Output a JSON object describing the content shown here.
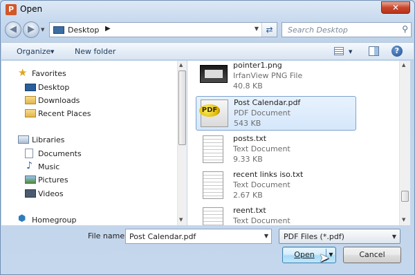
{
  "window": {
    "title": "Open",
    "app_icon_letter": "P"
  },
  "address": {
    "location": "Desktop",
    "search_placeholder": "Search Desktop"
  },
  "toolbar": {
    "organize_label": "Organize",
    "new_folder_label": "New folder",
    "help_label": "?"
  },
  "nav": {
    "favorites": "Favorites",
    "favorites_items": [
      "Desktop",
      "Downloads",
      "Recent Places"
    ],
    "libraries": "Libraries",
    "libraries_items": [
      "Documents",
      "Music",
      "Pictures",
      "Videos"
    ],
    "homegroup": "Homegroup"
  },
  "files": [
    {
      "name": "pointer1.png",
      "type": "IrfanView PNG File",
      "size": "40.8 KB",
      "icon": "image-thumbnail-icon"
    },
    {
      "name": "Post Calendar.pdf",
      "type": "PDF Document",
      "size": "543 KB",
      "icon": "pdf-file-icon",
      "selected": true
    },
    {
      "name": "posts.txt",
      "type": "Text Document",
      "size": "9.33 KB",
      "icon": "text-file-icon"
    },
    {
      "name": "recent links iso.txt",
      "type": "Text Document",
      "size": "2.67 KB",
      "icon": "text-file-icon"
    },
    {
      "name": "reent.txt",
      "type": "Text Document",
      "size": "",
      "icon": "text-file-icon"
    }
  ],
  "footer": {
    "file_name_label": "File name:",
    "file_name_value": "Post Calendar.pdf",
    "file_type_value": "PDF Files (*.pdf)",
    "open_label": "Open",
    "cancel_label": "Cancel"
  },
  "pdf_badge_text": "PDF",
  "colors": {
    "selection": "#d5e7fb",
    "accent": "#3c7fb1",
    "close_button": "#c9462c"
  }
}
